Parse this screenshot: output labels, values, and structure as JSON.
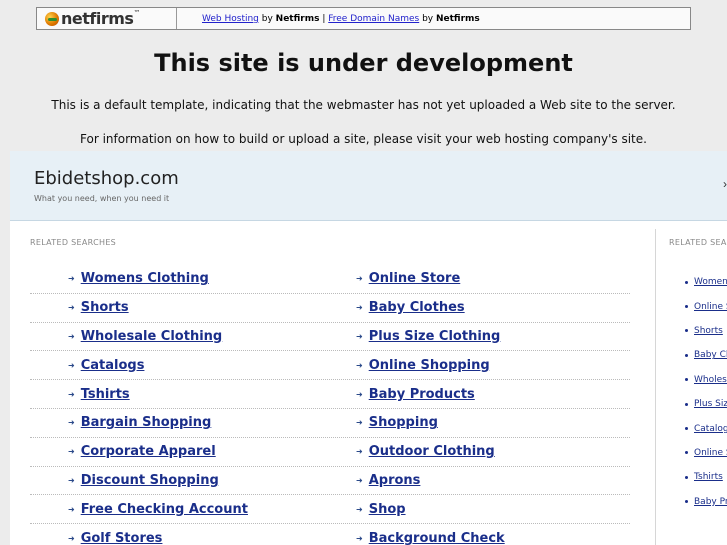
{
  "netfirms": {
    "brand": "netfirms",
    "trademark": "™",
    "link1": "Web Hosting",
    "by1": " by ",
    "brand1": "Netfirms",
    "separator": " | ",
    "link2": "Free Domain Names",
    "by2": " by ",
    "brand2": "Netfirms"
  },
  "dev": {
    "title": "This site is under development",
    "line1": "This is a default template, indicating that the webmaster has not yet uploaded a Web site to the server.",
    "line2": "For information on how to build or upload a site, please visit your web hosting company's site."
  },
  "parked": {
    "site_name": "Ebidetshop.com",
    "tagline": "What you need, when you need it",
    "chevron": "›",
    "related_label": "RELATED SEARCHES",
    "side_label": "RELATED SEARCHES",
    "main_rows": [
      [
        "Womens Clothing",
        "Online Store"
      ],
      [
        "Shorts",
        "Baby Clothes"
      ],
      [
        "Wholesale Clothing",
        "Plus Size Clothing"
      ],
      [
        "Catalogs",
        "Online Shopping"
      ],
      [
        "Tshirts",
        "Baby Products"
      ],
      [
        "Bargain Shopping",
        "Shopping"
      ],
      [
        "Corporate Apparel",
        "Outdoor Clothing"
      ],
      [
        "Discount Shopping",
        "Aprons"
      ],
      [
        "Free Checking Account",
        "Shop"
      ],
      [
        "Golf Stores",
        "Background Check"
      ]
    ],
    "side_items": [
      "Womens Clothing",
      "Online Store",
      "Shorts",
      "Baby Clothes",
      "Wholesale Clothing",
      "Plus Size Clothing",
      "Catalogs",
      "Online Shopping",
      "Tshirts",
      "Baby Products"
    ]
  }
}
